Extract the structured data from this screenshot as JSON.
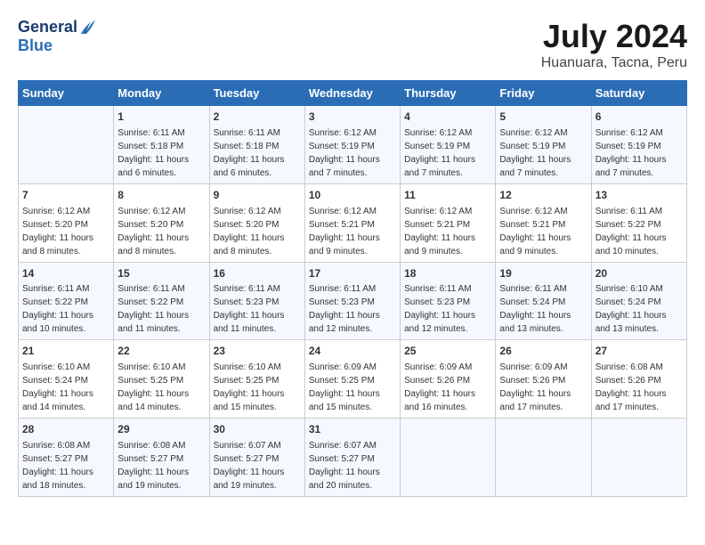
{
  "logo": {
    "line1": "General",
    "line2": "Blue"
  },
  "title": "July 2024",
  "subtitle": "Huanuara, Tacna, Peru",
  "weekdays": [
    "Sunday",
    "Monday",
    "Tuesday",
    "Wednesday",
    "Thursday",
    "Friday",
    "Saturday"
  ],
  "weeks": [
    [
      {
        "day": "",
        "sunrise": "",
        "sunset": "",
        "daylight": ""
      },
      {
        "day": "1",
        "sunrise": "6:11 AM",
        "sunset": "5:18 PM",
        "daylight": "11 hours and 6 minutes."
      },
      {
        "day": "2",
        "sunrise": "6:11 AM",
        "sunset": "5:18 PM",
        "daylight": "11 hours and 6 minutes."
      },
      {
        "day": "3",
        "sunrise": "6:12 AM",
        "sunset": "5:19 PM",
        "daylight": "11 hours and 7 minutes."
      },
      {
        "day": "4",
        "sunrise": "6:12 AM",
        "sunset": "5:19 PM",
        "daylight": "11 hours and 7 minutes."
      },
      {
        "day": "5",
        "sunrise": "6:12 AM",
        "sunset": "5:19 PM",
        "daylight": "11 hours and 7 minutes."
      },
      {
        "day": "6",
        "sunrise": "6:12 AM",
        "sunset": "5:19 PM",
        "daylight": "11 hours and 7 minutes."
      }
    ],
    [
      {
        "day": "7",
        "sunrise": "6:12 AM",
        "sunset": "5:20 PM",
        "daylight": "11 hours and 8 minutes."
      },
      {
        "day": "8",
        "sunrise": "6:12 AM",
        "sunset": "5:20 PM",
        "daylight": "11 hours and 8 minutes."
      },
      {
        "day": "9",
        "sunrise": "6:12 AM",
        "sunset": "5:20 PM",
        "daylight": "11 hours and 8 minutes."
      },
      {
        "day": "10",
        "sunrise": "6:12 AM",
        "sunset": "5:21 PM",
        "daylight": "11 hours and 9 minutes."
      },
      {
        "day": "11",
        "sunrise": "6:12 AM",
        "sunset": "5:21 PM",
        "daylight": "11 hours and 9 minutes."
      },
      {
        "day": "12",
        "sunrise": "6:12 AM",
        "sunset": "5:21 PM",
        "daylight": "11 hours and 9 minutes."
      },
      {
        "day": "13",
        "sunrise": "6:11 AM",
        "sunset": "5:22 PM",
        "daylight": "11 hours and 10 minutes."
      }
    ],
    [
      {
        "day": "14",
        "sunrise": "6:11 AM",
        "sunset": "5:22 PM",
        "daylight": "11 hours and 10 minutes."
      },
      {
        "day": "15",
        "sunrise": "6:11 AM",
        "sunset": "5:22 PM",
        "daylight": "11 hours and 11 minutes."
      },
      {
        "day": "16",
        "sunrise": "6:11 AM",
        "sunset": "5:23 PM",
        "daylight": "11 hours and 11 minutes."
      },
      {
        "day": "17",
        "sunrise": "6:11 AM",
        "sunset": "5:23 PM",
        "daylight": "11 hours and 12 minutes."
      },
      {
        "day": "18",
        "sunrise": "6:11 AM",
        "sunset": "5:23 PM",
        "daylight": "11 hours and 12 minutes."
      },
      {
        "day": "19",
        "sunrise": "6:11 AM",
        "sunset": "5:24 PM",
        "daylight": "11 hours and 13 minutes."
      },
      {
        "day": "20",
        "sunrise": "6:10 AM",
        "sunset": "5:24 PM",
        "daylight": "11 hours and 13 minutes."
      }
    ],
    [
      {
        "day": "21",
        "sunrise": "6:10 AM",
        "sunset": "5:24 PM",
        "daylight": "11 hours and 14 minutes."
      },
      {
        "day": "22",
        "sunrise": "6:10 AM",
        "sunset": "5:25 PM",
        "daylight": "11 hours and 14 minutes."
      },
      {
        "day": "23",
        "sunrise": "6:10 AM",
        "sunset": "5:25 PM",
        "daylight": "11 hours and 15 minutes."
      },
      {
        "day": "24",
        "sunrise": "6:09 AM",
        "sunset": "5:25 PM",
        "daylight": "11 hours and 15 minutes."
      },
      {
        "day": "25",
        "sunrise": "6:09 AM",
        "sunset": "5:26 PM",
        "daylight": "11 hours and 16 minutes."
      },
      {
        "day": "26",
        "sunrise": "6:09 AM",
        "sunset": "5:26 PM",
        "daylight": "11 hours and 17 minutes."
      },
      {
        "day": "27",
        "sunrise": "6:08 AM",
        "sunset": "5:26 PM",
        "daylight": "11 hours and 17 minutes."
      }
    ],
    [
      {
        "day": "28",
        "sunrise": "6:08 AM",
        "sunset": "5:27 PM",
        "daylight": "11 hours and 18 minutes."
      },
      {
        "day": "29",
        "sunrise": "6:08 AM",
        "sunset": "5:27 PM",
        "daylight": "11 hours and 19 minutes."
      },
      {
        "day": "30",
        "sunrise": "6:07 AM",
        "sunset": "5:27 PM",
        "daylight": "11 hours and 19 minutes."
      },
      {
        "day": "31",
        "sunrise": "6:07 AM",
        "sunset": "5:27 PM",
        "daylight": "11 hours and 20 minutes."
      },
      {
        "day": "",
        "sunrise": "",
        "sunset": "",
        "daylight": ""
      },
      {
        "day": "",
        "sunrise": "",
        "sunset": "",
        "daylight": ""
      },
      {
        "day": "",
        "sunrise": "",
        "sunset": "",
        "daylight": ""
      }
    ]
  ],
  "labels": {
    "sunrise": "Sunrise:",
    "sunset": "Sunset:",
    "daylight": "Daylight:"
  }
}
